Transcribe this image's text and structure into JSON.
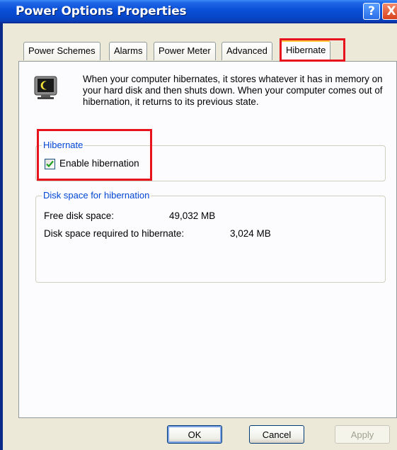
{
  "window": {
    "title": "Power Options Properties"
  },
  "title_buttons": {
    "help": "?",
    "close": "X"
  },
  "tabs": [
    {
      "label": "Power Schemes"
    },
    {
      "label": "Alarms"
    },
    {
      "label": "Power Meter"
    },
    {
      "label": "Advanced"
    },
    {
      "label": "Hibernate"
    }
  ],
  "hibernate_tab": {
    "description": "When your computer hibernates, it stores whatever it has in memory on your hard disk and then shuts down. When your computer comes out of hibernation, it returns to its previous state.",
    "hibernate_group": {
      "legend": "Hibernate",
      "enable_label": "Enable hibernation",
      "enable_checked": true
    },
    "disk_group": {
      "legend": "Disk space for hibernation",
      "free_label": "Free disk space:",
      "free_value": "49,032 MB",
      "required_label": "Disk space required to hibernate:",
      "required_value": "3,024 MB"
    }
  },
  "buttons": {
    "ok": "OK",
    "cancel": "Cancel",
    "apply": "Apply"
  },
  "colors": {
    "title_bar": "#0a4fd8",
    "legend_text": "#0046d5",
    "highlight_box": "#e8141d",
    "active_tab_accent": "#ffc83c"
  }
}
